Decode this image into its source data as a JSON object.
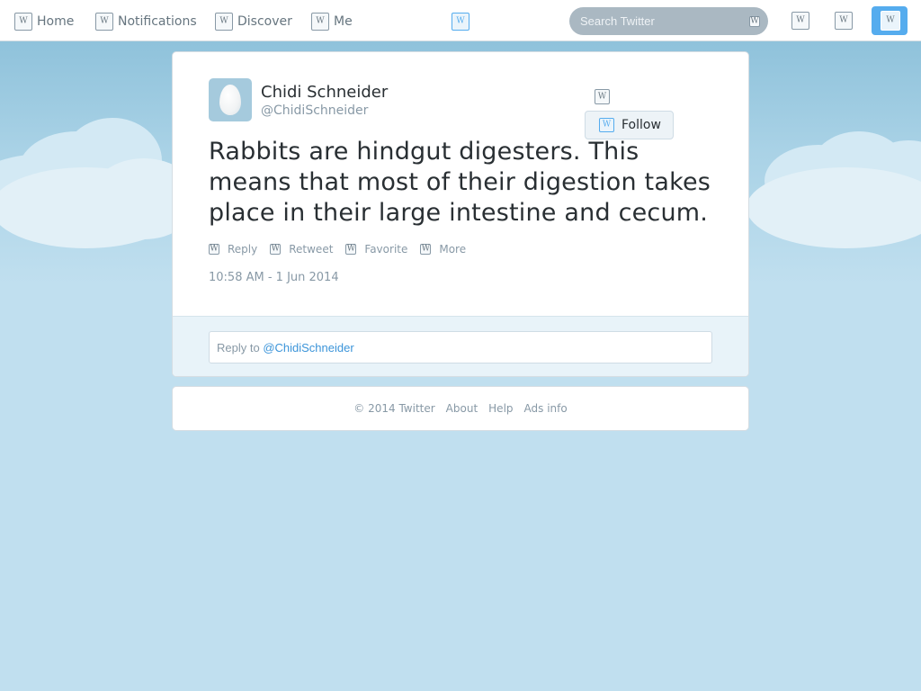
{
  "nav": {
    "home": "Home",
    "notifications": "Notifications",
    "discover": "Discover",
    "me": "Me"
  },
  "search": {
    "placeholder": "Search Twitter"
  },
  "tweet": {
    "fullname": "Chidi Schneider",
    "screenname": "@ChidiSchneider",
    "follow_label": "Follow",
    "text": "Rabbits are hindgut digesters. This means that most of their digestion takes place in their large intestine and cecum.",
    "actions": {
      "reply": "Reply",
      "retweet": "Retweet",
      "favorite": "Favorite",
      "more": "More"
    },
    "timestamp": "10:58 AM - 1 Jun 2014"
  },
  "reply": {
    "prefix": "Reply to ",
    "mention": "@ChidiSchneider"
  },
  "footer": {
    "copyright": "© 2014 Twitter",
    "about": "About",
    "help": "Help",
    "ads_info": "Ads info"
  },
  "colors": {
    "accent": "#55acee",
    "background": "#c0dfef",
    "text": "#292f33",
    "muted": "#8899a6"
  }
}
